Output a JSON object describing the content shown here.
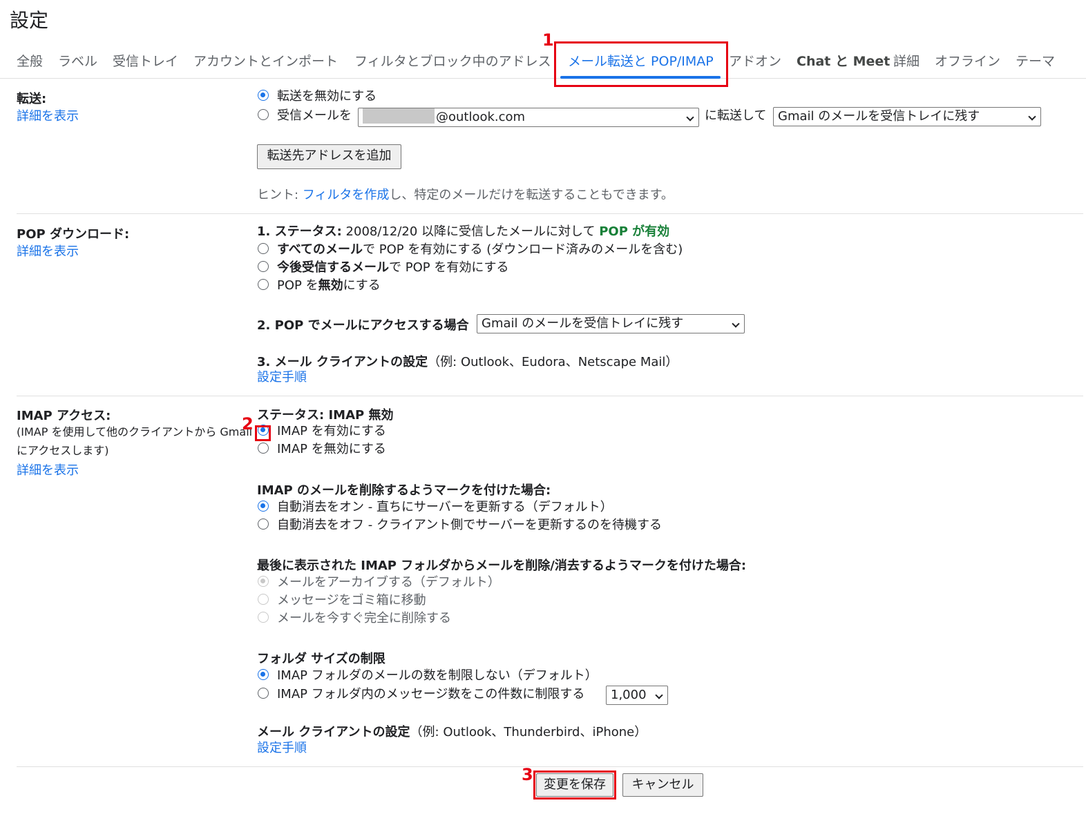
{
  "page_title": "設定",
  "tabs": [
    {
      "label": "全般"
    },
    {
      "label": "ラベル"
    },
    {
      "label": "受信トレイ"
    },
    {
      "label": "アカウントとインポート"
    },
    {
      "label": "フィルタとブロック中のアドレス"
    },
    {
      "label": "メール転送と POP/IMAP",
      "active": true
    },
    {
      "label": "アドオン"
    },
    {
      "label": "Chat と Meet"
    },
    {
      "label": "詳細"
    },
    {
      "label": "オフライン"
    },
    {
      "label": "テーマ"
    }
  ],
  "annotations": {
    "one": "1",
    "two": "2",
    "three": "3"
  },
  "forwarding": {
    "label": "転送:",
    "more_link": "詳細を表示",
    "disable_option": "転送を無効にする",
    "forward_prefix": "受信メールを",
    "address_suffix": "@outlook.com",
    "forward_middle": "に転送して",
    "action_select": "Gmail のメールを受信トレイに残す",
    "add_button": "転送先アドレスを追加",
    "hint_prefix": "ヒント: ",
    "hint_link": "フィルタを作成",
    "hint_suffix": "し、特定のメールだけを転送することもできます。"
  },
  "pop": {
    "label": "POP ダウンロード:",
    "more_link": "詳細を表示",
    "status_heading": "1. ステータス:",
    "status_text": " 2008/12/20 以降に受信したメールに対して ",
    "status_value": "POP が有効",
    "opt_all_bold": "すべてのメール",
    "opt_all_rest": "で POP を有効にする (ダウンロード済みのメールを含む)",
    "opt_future_bold": "今後受信するメール",
    "opt_future_rest": "で POP を有効にする",
    "opt_disable_pre": "POP を",
    "opt_disable_bold": "無効",
    "opt_disable_post": "にする",
    "access_heading": "2. POP でメールにアクセスする場合",
    "access_select": "Gmail のメールを受信トレイに残す",
    "client_heading": "3. メール クライアントの設定",
    "client_note": "（例: Outlook、Eudora、Netscape Mail）",
    "setup_link": "設定手順"
  },
  "imap": {
    "label": "IMAP アクセス:",
    "note_line1": "(IMAP を使用して他のクライアントから Gmail",
    "note_line2": "にアクセスします)",
    "more_link": "詳細を表示",
    "status_heading": "ステータス: IMAP 無効",
    "enable_option": "IMAP を有効にする",
    "disable_option": "IMAP を無効にする",
    "delete_heading": "IMAP のメールを削除するようマークを付けた場合:",
    "expunge_on": "自動消去をオン - 直ちにサーバーを更新する（デフォルト）",
    "expunge_off": "自動消去をオフ - クライアント側でサーバーを更新するのを待機する",
    "last_folder_heading": "最後に表示された IMAP フォルダからメールを削除/消去するようマークを付けた場合:",
    "archive_option": "メールをアーカイブする（デフォルト）",
    "trash_option": "メッセージをゴミ箱に移動",
    "delete_option": "メールを今すぐ完全に削除する",
    "folder_size_heading": "フォルダ サイズの制限",
    "no_limit_option": "IMAP フォルダのメールの数を制限しない（デフォルト）",
    "limit_option": "IMAP フォルダ内のメッセージ数をこの件数に制限する",
    "limit_select": "1,000",
    "client_heading": "メール クライアントの設定",
    "client_note": "（例: Outlook、Thunderbird、iPhone）",
    "setup_link": "設定手順"
  },
  "footer": {
    "save_button": "変更を保存",
    "cancel_button": "キャンセル"
  },
  "colors": {
    "accent": "#1a73e8",
    "annotation_red": "#e60012",
    "pop_enabled_green": "#188038"
  }
}
